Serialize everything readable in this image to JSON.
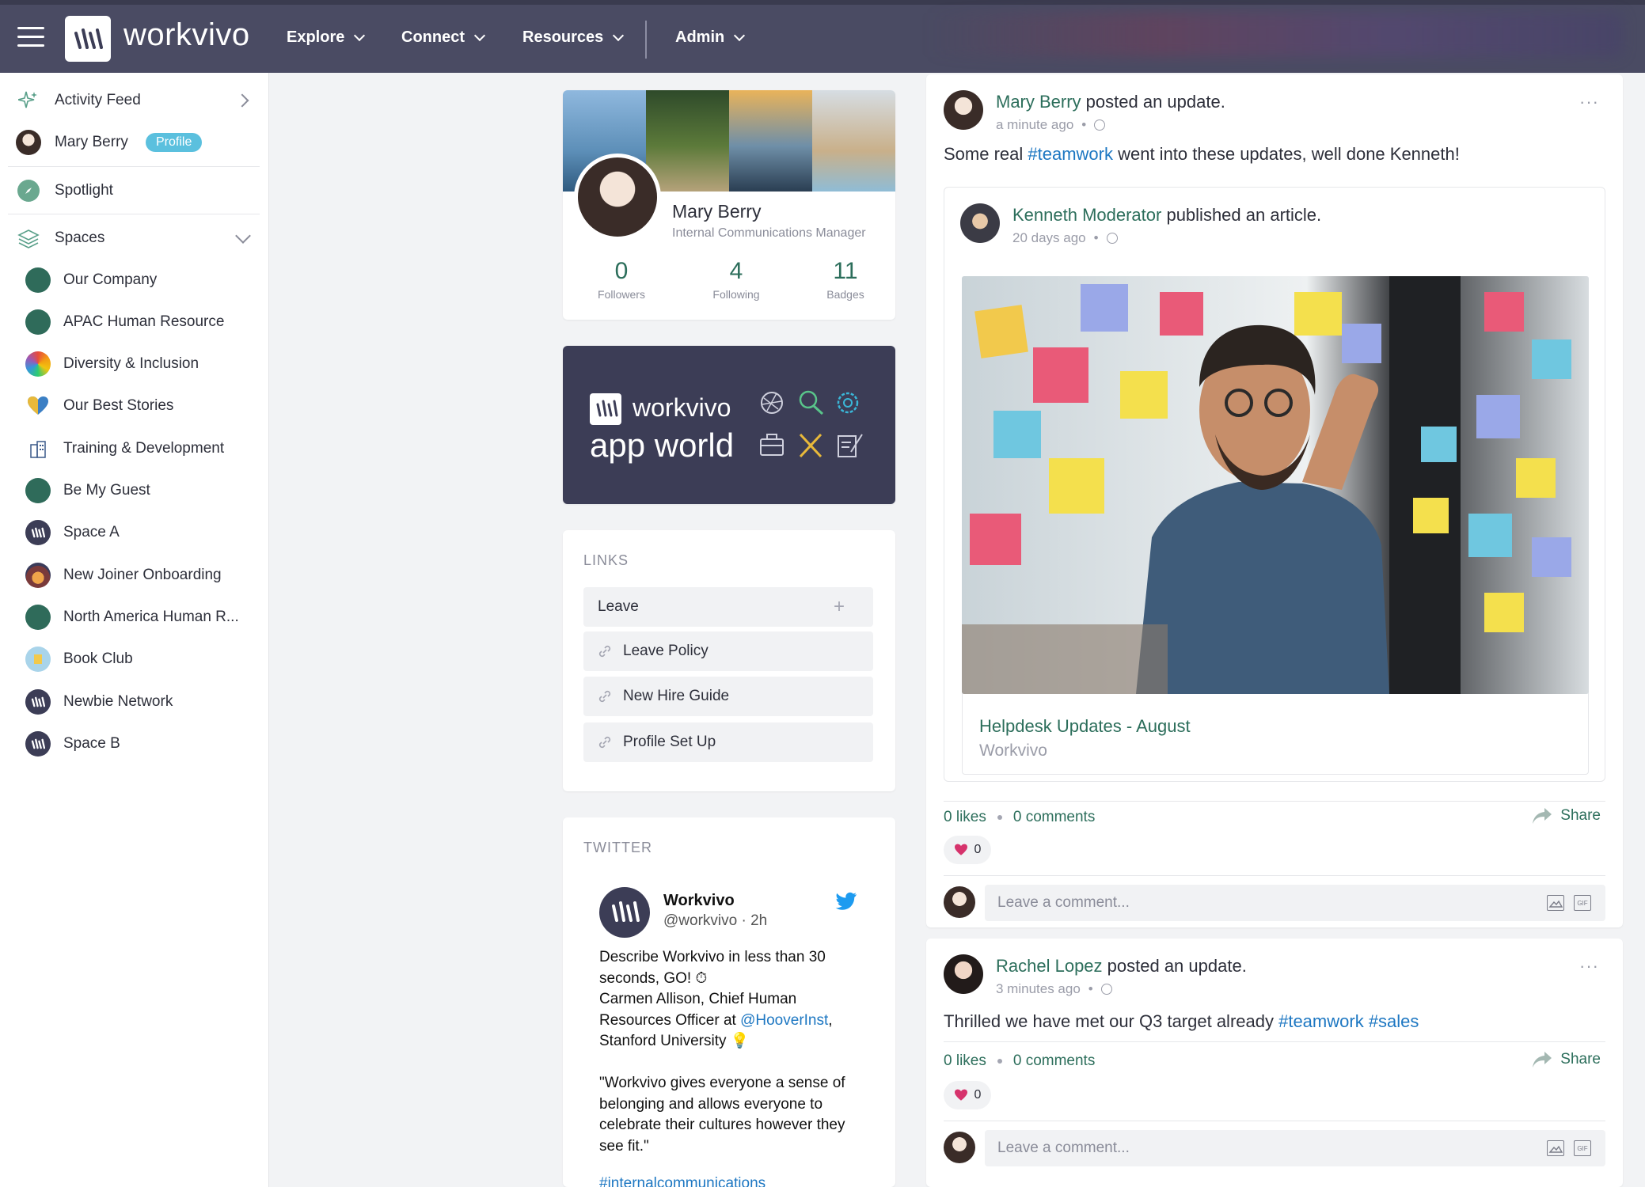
{
  "app": {
    "brand": "workvivo"
  },
  "nav": {
    "explore": "Explore",
    "connect": "Connect",
    "resources": "Resources",
    "admin": "Admin"
  },
  "sidebar": {
    "activity_feed": "Activity Feed",
    "user_name": "Mary Berry",
    "profile_badge": "Profile",
    "spotlight": "Spotlight",
    "spaces": "Spaces",
    "space_items": [
      "Our Company",
      "APAC Human Resource",
      "Diversity & Inclusion",
      "Our Best Stories",
      "Training & Development",
      "Be My Guest",
      "Space A",
      "New Joiner Onboarding",
      "North America Human R...",
      "Book Club",
      "Newbie Network",
      "Space B"
    ]
  },
  "profile_card": {
    "name": "Mary Berry",
    "role": "Internal Communications Manager",
    "followers": {
      "value": "0",
      "label": "Followers"
    },
    "following": {
      "value": "4",
      "label": "Following"
    },
    "badges": {
      "value": "11",
      "label": "Badges"
    }
  },
  "app_world": {
    "title": "workvivo",
    "subtitle": "app world"
  },
  "links": {
    "title": "LINKS",
    "group": "Leave",
    "add": "+",
    "items": [
      "Leave Policy",
      "New Hire Guide",
      "Profile Set Up"
    ]
  },
  "twitter": {
    "title": "TWITTER",
    "name": "Workvivo",
    "handle": "@workvivo · 2h",
    "line1": "Describe Workvivo in less than 30 seconds, GO! ⏱",
    "line2a": "Carmen Allison, Chief Human Resources Officer at ",
    "mention": "@HooverInst",
    "line2b": ", Stanford University 💡",
    "quote": "\"Workvivo gives everyone a sense of belonging and allows everyone to celebrate their cultures however they see fit.\"",
    "hashtag": "#internalcommunications"
  },
  "feed": {
    "post1": {
      "author": "Mary Berry",
      "action": " posted an update.",
      "time": "a minute ago",
      "text_a": "Some real ",
      "tag": "#teamwork",
      "text_b": " went into these updates, well done Kenneth!",
      "shared": {
        "author": "Kenneth Moderator",
        "action": " published an article.",
        "time": "20 days ago",
        "article_title": "Helpdesk Updates - August",
        "article_source": "Workvivo"
      },
      "likes": "0 likes",
      "comments": "0 comments",
      "share": "Share",
      "heart_count": "0",
      "comment_placeholder": "Leave a comment..."
    },
    "post2": {
      "author": "Rachel Lopez",
      "action": " posted an update.",
      "time": "3 minutes ago",
      "text": "Thrilled we have met our Q3 target already ",
      "tag1": "#teamwork",
      "tag2": "#sales",
      "likes": "0 likes",
      "comments": "0 comments",
      "share": "Share",
      "heart_count": "0",
      "comment_placeholder": "Leave a comment..."
    },
    "more": "···",
    "gif": "GIF"
  },
  "colors": {
    "topbar": "#4a4b63",
    "accent_green": "#2c6e5b",
    "link_blue": "#1d77c2",
    "badge": "#5bc0de"
  }
}
